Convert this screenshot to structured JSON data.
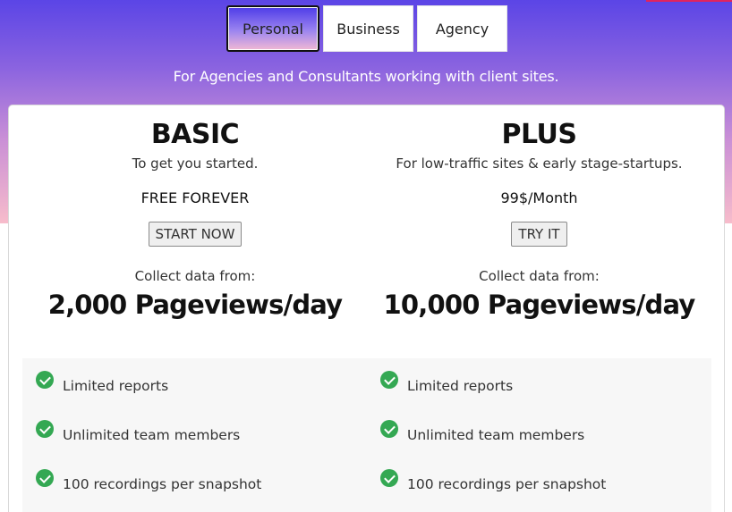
{
  "tabs": [
    {
      "label": "Personal",
      "active": true
    },
    {
      "label": "Business",
      "active": false
    },
    {
      "label": "Agency",
      "active": false
    }
  ],
  "tagline": "For Agencies and Consultants working with client sites.",
  "plans": [
    {
      "name": "BASIC",
      "description": "To get you started.",
      "price": "FREE FOREVER",
      "cta": "START NOW",
      "collect_label": "Collect data from:",
      "collect_value": "2,000 Pageviews/day",
      "features": [
        "Limited reports",
        "Unlimited team members",
        "100 recordings per snapshot"
      ]
    },
    {
      "name": "PLUS",
      "description": "For low-traffic sites & early stage-startups.",
      "price": "99$/Month",
      "cta": "TRY IT",
      "collect_label": "Collect data from:",
      "collect_value": "10,000 Pageviews/day",
      "features": [
        "Limited reports",
        "Unlimited team members",
        "100 recordings per snapshot"
      ]
    }
  ],
  "icons": {
    "feature_check": "check-circle-icon"
  },
  "colors": {
    "check": "#34a853",
    "hero_top": "#5b45e6",
    "hero_bottom": "#f7bccb",
    "accent_line": "#e0245e"
  }
}
